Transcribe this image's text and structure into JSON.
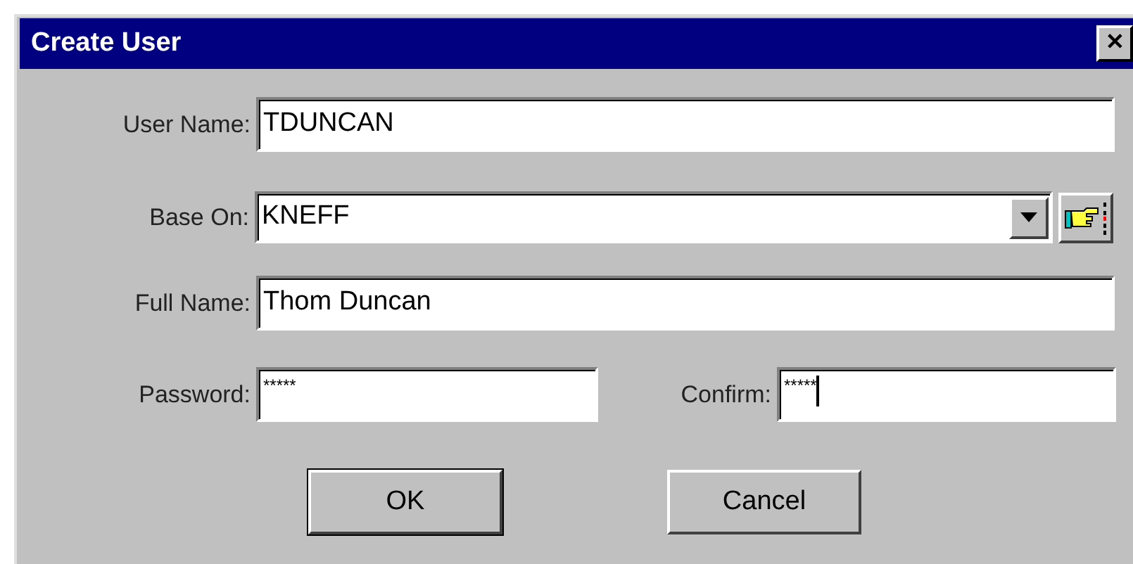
{
  "window": {
    "title": "Create User",
    "close": "✕"
  },
  "user_name": {
    "label": "User Name:",
    "value": "TDUNCAN"
  },
  "base_on": {
    "label": "Base On:",
    "value": "KNEFF"
  },
  "full_name": {
    "label": "Full Name:",
    "value": "Thom Duncan"
  },
  "password": {
    "label": "Password:",
    "value": "*****",
    "focused": false
  },
  "confirm": {
    "label": "Confirm:",
    "value": "*****",
    "focused": true
  },
  "buttons": [
    {
      "label": "OK",
      "default": true
    },
    {
      "label": "Cancel",
      "default": false
    }
  ]
}
